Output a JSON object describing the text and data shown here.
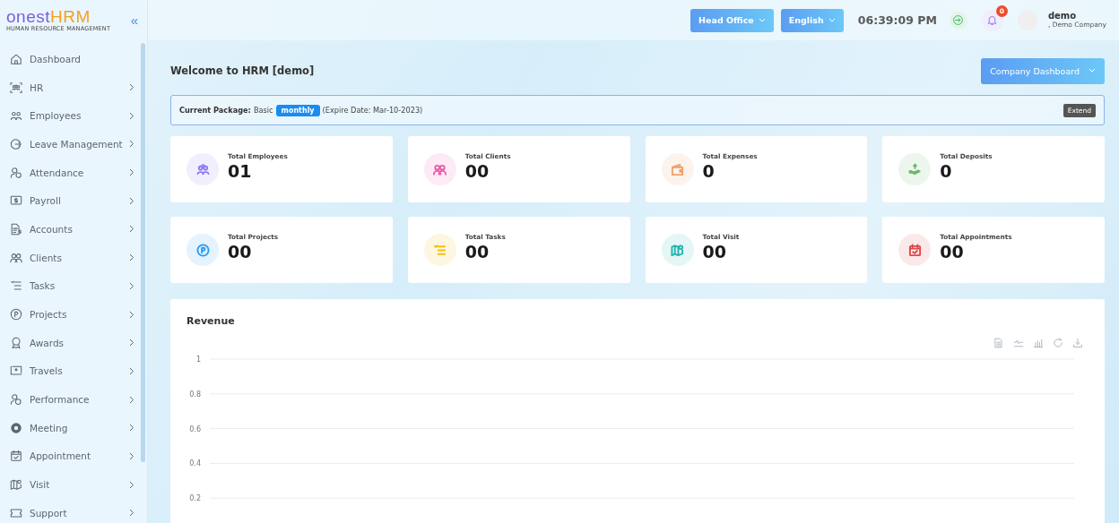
{
  "logo": {
    "part_1": "onest",
    "part_2": "HRM",
    "tagline": "HUMAN RESOURCE MANAGEMENT"
  },
  "sidebar": {
    "collapse_icon": "«",
    "items": [
      {
        "label": "Dashboard",
        "expandable": false
      },
      {
        "label": "HR",
        "expandable": true
      },
      {
        "label": "Employees",
        "expandable": true
      },
      {
        "label": "Leave Management",
        "expandable": true
      },
      {
        "label": "Attendance",
        "expandable": true
      },
      {
        "label": "Payroll",
        "expandable": true
      },
      {
        "label": "Accounts",
        "expandable": true
      },
      {
        "label": "Clients",
        "expandable": true
      },
      {
        "label": "Tasks",
        "expandable": true
      },
      {
        "label": "Projects",
        "expandable": true
      },
      {
        "label": "Awards",
        "expandable": true
      },
      {
        "label": "Travels",
        "expandable": true
      },
      {
        "label": "Performance",
        "expandable": true
      },
      {
        "label": "Meeting",
        "expandable": true
      },
      {
        "label": "Appointment",
        "expandable": true
      },
      {
        "label": "Visit",
        "expandable": true
      },
      {
        "label": "Support",
        "expandable": true
      }
    ]
  },
  "header": {
    "branch": "Head Office",
    "language": "English",
    "time": "06:39:09 PM",
    "notification_count": "0",
    "user_name": "demo",
    "user_company": ", Demo Company"
  },
  "page": {
    "title": "Welcome to HRM [demo]",
    "dashboard_switch": "Company Dashboard"
  },
  "package": {
    "label": "Current Package:",
    "plan": "Basic",
    "period": "monthly",
    "expiry": "(Expire Date: Mar-10-2023)",
    "action": "Extend"
  },
  "stats": [
    {
      "label": "Total Employees",
      "value": "01",
      "color": "#8b7cf0"
    },
    {
      "label": "Total Clients",
      "value": "00",
      "color": "#e85aa8"
    },
    {
      "label": "Total Expenses",
      "value": "0",
      "color": "#f0a06a"
    },
    {
      "label": "Total Deposits",
      "value": "0",
      "color": "#6cb86c"
    },
    {
      "label": "Total Projects",
      "value": "00",
      "color": "#2a9df4"
    },
    {
      "label": "Total Tasks",
      "value": "00",
      "color": "#f2c010"
    },
    {
      "label": "Total Visit",
      "value": "00",
      "color": "#22b3b0"
    },
    {
      "label": "Total Appointments",
      "value": "00",
      "color": "#e04848"
    }
  ],
  "revenue": {
    "title": "Revenue",
    "axis_labels": [
      "1",
      "0.8",
      "0.6",
      "0.4",
      "0.2"
    ]
  }
}
